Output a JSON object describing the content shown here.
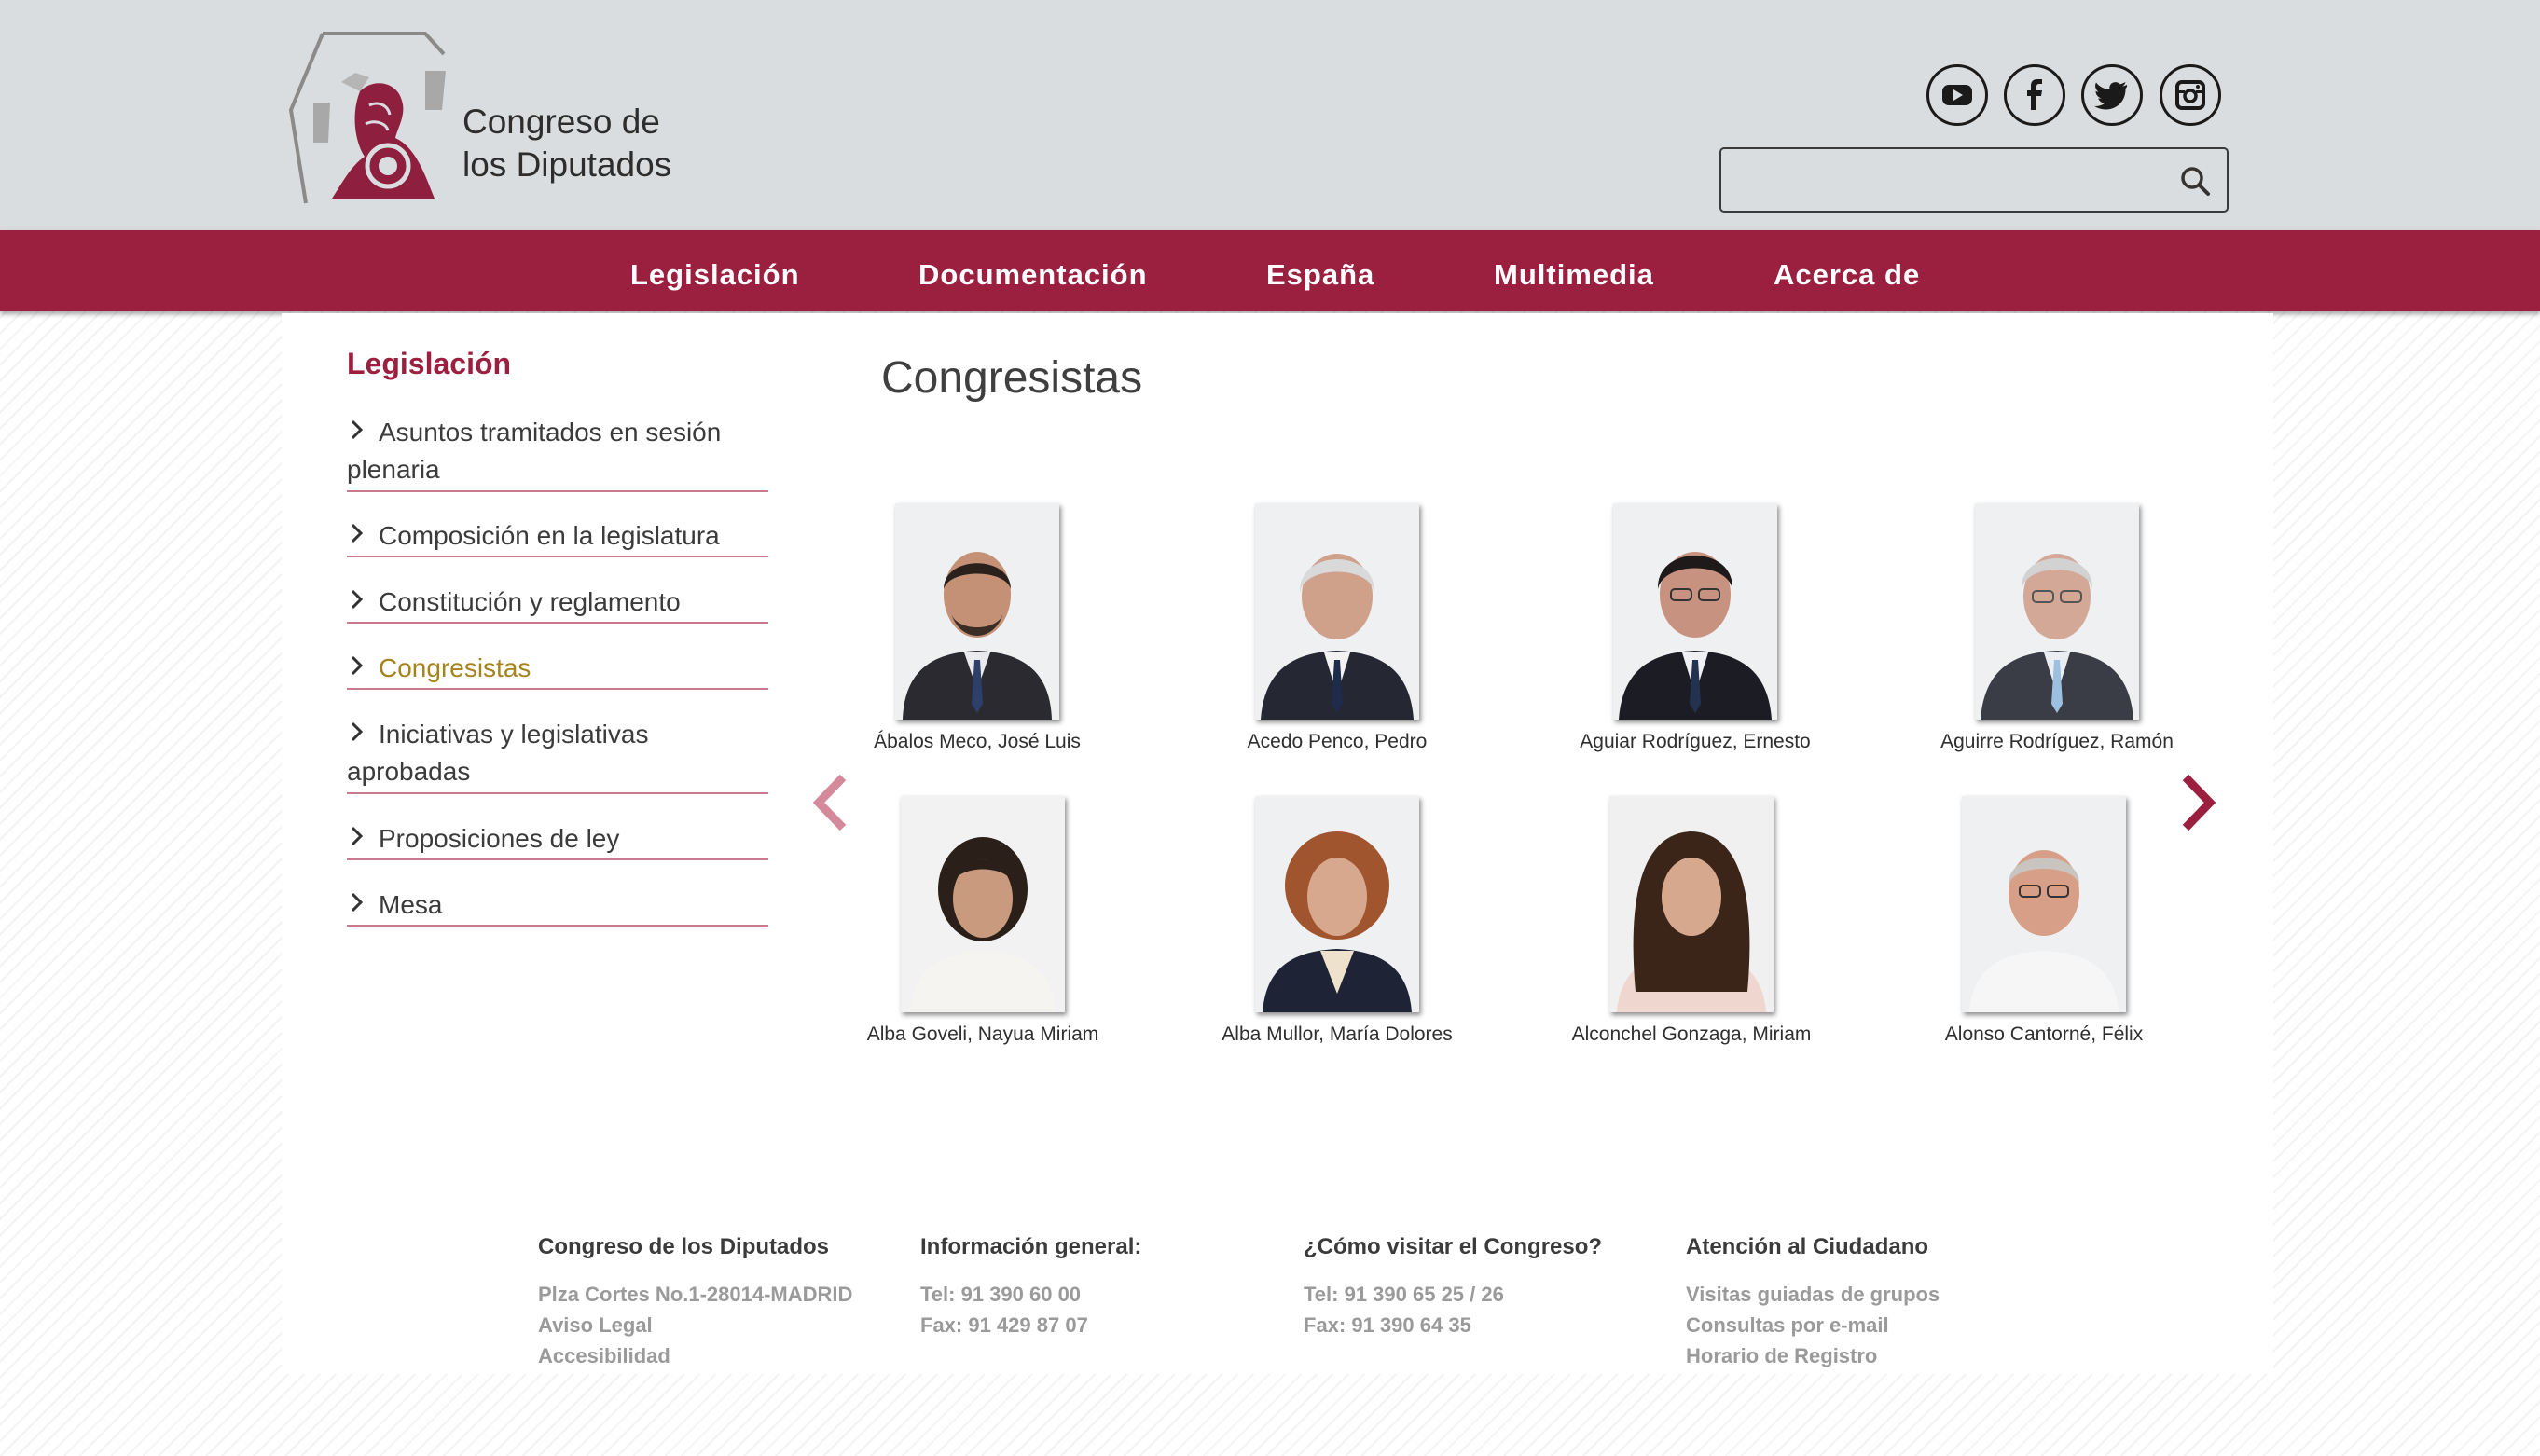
{
  "header": {
    "logo_text": "Congreso de\nlos Diputados",
    "social": [
      {
        "icon": "youtube-icon"
      },
      {
        "icon": "facebook-icon"
      },
      {
        "icon": "twitter-icon"
      },
      {
        "icon": "instagram-icon"
      }
    ],
    "search": {
      "value": "",
      "placeholder": ""
    }
  },
  "nav": {
    "items": [
      "Legislación",
      "Documentación",
      "España",
      "Multimedia",
      "Acerca de"
    ]
  },
  "sidebar": {
    "title": "Legislación",
    "items": [
      {
        "label": "Asuntos tramitados en sesión plenaria",
        "active": false
      },
      {
        "label": "Composición en la legislatura",
        "active": false
      },
      {
        "label": "Constitución y reglamento",
        "active": false
      },
      {
        "label": "Congresistas",
        "active": true
      },
      {
        "label": "Iniciativas y legislativas aprobadas",
        "active": false
      },
      {
        "label": "Proposiciones de ley",
        "active": false
      },
      {
        "label": "Mesa",
        "active": false
      }
    ]
  },
  "main": {
    "title": "Congresistas",
    "members": [
      "Ábalos Meco, José Luis",
      "Acedo Penco, Pedro",
      "Aguiar Rodríguez, Ernesto",
      "Aguirre Rodríguez, Ramón",
      "Alba Goveli, Nayua Miriam",
      "Alba Mullor, María Dolores",
      "Alconchel Gonzaga, Miriam",
      "Alonso Cantorné, Félix"
    ]
  },
  "footer": {
    "columns": [
      {
        "heading": "Congreso de los Diputados",
        "lines": [
          "Plza Cortes No.1-28014-MADRID",
          "Aviso Legal",
          "Accesibilidad"
        ]
      },
      {
        "heading": "Información general:",
        "lines": [
          "Tel: 91 390 60 00",
          "Fax: 91 429 87 07"
        ]
      },
      {
        "heading": "¿Cómo visitar el Congreso?",
        "lines": [
          "Tel: 91 390 65 25 / 26",
          "Fax: 91 390 64 35"
        ]
      },
      {
        "heading": "Atención al Ciudadano",
        "lines": [
          "Visitas guiadas de grupos",
          "Consultas por e-mail",
          "Horario de Registro"
        ]
      }
    ]
  },
  "colors": {
    "brand": "#9b1f3e",
    "header_bg": "#dadddf",
    "active_link": "#a5841e",
    "prev_arrow": "#d58a9c",
    "next_arrow": "#9b1f3e"
  }
}
